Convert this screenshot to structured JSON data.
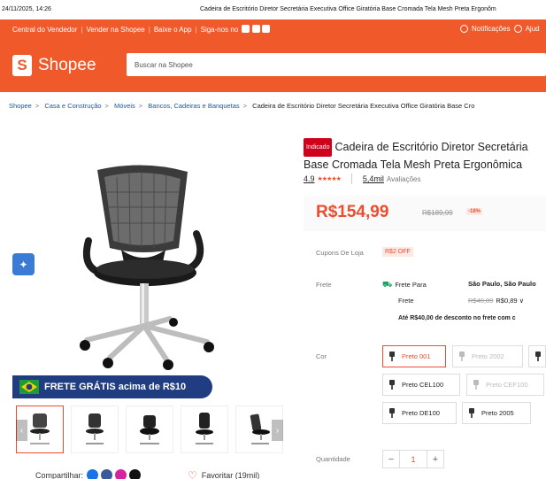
{
  "print": {
    "date": "24/11/2025, 14:26",
    "title": "Cadeira de Escritório Diretor Secretária Executiva Office Giratória Base Cromada Tela Mesh Preta Ergonôm"
  },
  "topnav": {
    "left": [
      "Central do Vendedor",
      "Vender na Shopee",
      "Baixe o App",
      "Siga-nos no"
    ],
    "notifications": "Notificações",
    "help": "Ajud"
  },
  "header": {
    "logo_text": "Shopee",
    "search_placeholder": "Buscar na Shopee"
  },
  "breadcrumb": [
    "Shopee",
    "Casa e Construção",
    "Móveis",
    "Bancos, Cadeiras e Banquetas",
    "Cadeira de Escritório Diretor Secretária Executiva Office Giratória Base Cro"
  ],
  "banner": {
    "text": "FRETE GRÁTIS acima de R$10"
  },
  "share": {
    "label": "Compartilhar:",
    "favorite": "Favoritar (19mil)"
  },
  "product": {
    "tag": "Indicado",
    "title_line1": "Cadeira de Escritório Diretor Secretária",
    "title_line2": "Base Cromada Tela Mesh Preta Ergonômica",
    "rating": "4.9",
    "stars": "★★★★★",
    "rating_count": "5,4mil",
    "rating_label": "Avaliações",
    "price": "R$154,99",
    "old_price": "R$189,99",
    "discount": "-18%"
  },
  "coupons": {
    "label": "Cupons De Loja",
    "value": "R$2 OFF"
  },
  "shipping": {
    "label": "Frete",
    "to_label": "Frete Para",
    "destination": "São Paulo, São Paulo",
    "fee_label": "Frete",
    "old_fee": "R$40,89",
    "fee": "R$0,89 ∨",
    "note": "Até R$40,00 de desconto no frete com c"
  },
  "colors": {
    "label": "Cor",
    "options": [
      "Preto 001",
      "Preto 2002",
      "",
      "Preto CEL100",
      "Preto CEF100",
      "Preto DE100",
      "Preto 2005"
    ]
  },
  "quantity": {
    "label": "Quantidade",
    "minus": "−",
    "value": "1",
    "plus": "+"
  }
}
